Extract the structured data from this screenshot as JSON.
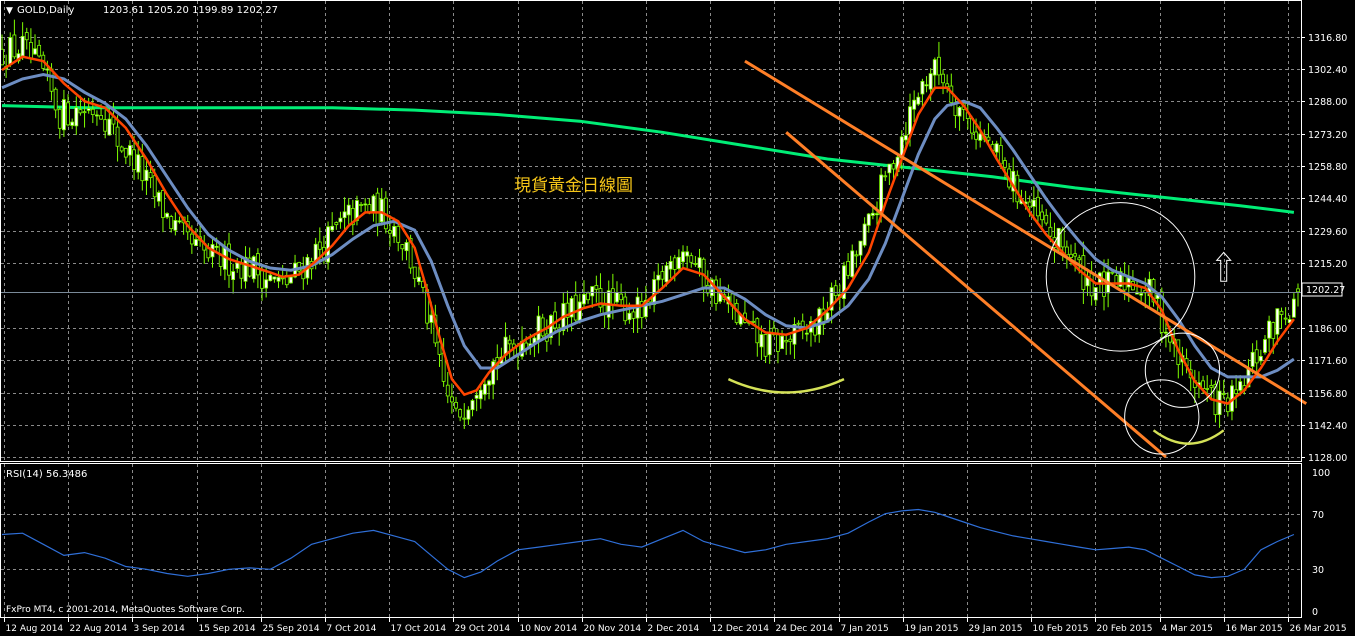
{
  "header": {
    "symbol": "GOLD,Daily",
    "ohlc": "1203.61 1205.20 1199.89 1202.27"
  },
  "annotation": "現貨黃金日線圖",
  "price_marker": "1202.27",
  "rsi_header": "RSI(14) 56.3486",
  "copyright": "FxPro MT4, c 2001-2014, MetaQuotes Software Corp.",
  "colors": {
    "background": "#000000",
    "grid": "#8a8a8a",
    "bull": "#7fff00",
    "bull_body": "#ffffff",
    "bear": "#7fff00",
    "ma_fast": "#ff4500",
    "ma_slow": "#6d8dc2",
    "ma_long": "#00ee76",
    "channel": "#ff7f27",
    "rsi": "#2f6fd8",
    "arc": "#d4e157",
    "text": "#ffffff"
  },
  "chart_data": [
    {
      "type": "candlestick",
      "title": "GOLD,Daily",
      "y_ticks": [
        1316.8,
        1302.4,
        1288.0,
        1273.2,
        1258.8,
        1244.4,
        1229.6,
        1215.2,
        1186.0,
        1171.6,
        1156.8,
        1142.4,
        1128.0
      ],
      "ylim": [
        1128.0,
        1320.0
      ],
      "x_tick_labels": [
        "12 Aug 2014",
        "22 Aug 2014",
        "3 Sep 2014",
        "15 Sep 2014",
        "25 Sep 2014",
        "7 Oct 2014",
        "17 Oct 2014",
        "29 Oct 2014",
        "10 Nov 2014",
        "20 Nov 2014",
        "2 Dec 2014",
        "12 Dec 2014",
        "24 Dec 2014",
        "7 Jan 2015",
        "19 Jan 2015",
        "29 Jan 2015",
        "10 Feb 2015",
        "20 Feb 2015",
        "4 Mar 2015",
        "16 Mar 2015",
        "26 Mar 2015"
      ],
      "last_price": 1202.27,
      "close_path": [
        [
          0,
          1310
        ],
        [
          5,
          1312
        ],
        [
          10,
          1300
        ],
        [
          14,
          1282
        ],
        [
          18,
          1284
        ],
        [
          24,
          1285
        ],
        [
          28,
          1270
        ],
        [
          32,
          1262
        ],
        [
          36,
          1248
        ],
        [
          40,
          1236
        ],
        [
          45,
          1224
        ],
        [
          50,
          1218
        ],
        [
          55,
          1216
        ],
        [
          60,
          1214
        ],
        [
          65,
          1208
        ],
        [
          68,
          1205
        ],
        [
          72,
          1212
        ],
        [
          76,
          1220
        ],
        [
          80,
          1228
        ],
        [
          84,
          1236
        ],
        [
          88,
          1240
        ],
        [
          92,
          1238
        ],
        [
          95,
          1232
        ],
        [
          98,
          1222
        ],
        [
          101,
          1205
        ],
        [
          104,
          1185
        ],
        [
          107,
          1160
        ],
        [
          110,
          1145
        ],
        [
          113,
          1155
        ],
        [
          116,
          1165
        ],
        [
          120,
          1172
        ],
        [
          125,
          1180
        ],
        [
          130,
          1185
        ],
        [
          135,
          1190
        ],
        [
          140,
          1195
        ],
        [
          144,
          1200
        ],
        [
          148,
          1196
        ],
        [
          152,
          1195
        ],
        [
          156,
          1192
        ],
        [
          160,
          1210
        ],
        [
          165,
          1224
        ],
        [
          170,
          1208
        ],
        [
          175,
          1198
        ],
        [
          180,
          1186
        ],
        [
          185,
          1178
        ],
        [
          190,
          1180
        ],
        [
          194,
          1184
        ],
        [
          198,
          1188
        ],
        [
          202,
          1202
        ],
        [
          206,
          1215
        ],
        [
          210,
          1232
        ],
        [
          213,
          1248
        ],
        [
          216,
          1262
        ],
        [
          219,
          1278
        ],
        [
          222,
          1292
        ],
        [
          225,
          1302
        ],
        [
          228,
          1300
        ],
        [
          231,
          1288
        ],
        [
          234,
          1280
        ],
        [
          237,
          1272
        ],
        [
          240,
          1266
        ],
        [
          243,
          1255
        ],
        [
          246,
          1248
        ],
        [
          249,
          1240
        ],
        [
          252,
          1232
        ],
        [
          255,
          1225
        ],
        [
          258,
          1222
        ],
        [
          261,
          1212
        ],
        [
          264,
          1206
        ],
        [
          267,
          1204
        ],
        [
          270,
          1205
        ],
        [
          273,
          1208
        ],
        [
          276,
          1205
        ],
        [
          279,
          1200
        ],
        [
          282,
          1186
        ],
        [
          285,
          1172
        ],
        [
          288,
          1165
        ],
        [
          291,
          1158
        ],
        [
          294,
          1153
        ],
        [
          297,
          1152
        ],
        [
          300,
          1156
        ],
        [
          303,
          1170
        ],
        [
          306,
          1180
        ],
        [
          309,
          1190
        ],
        [
          312,
          1196
        ],
        [
          314,
          1202.27
        ]
      ],
      "ma_fast": [
        [
          0,
          1302
        ],
        [
          5,
          1308
        ],
        [
          10,
          1306
        ],
        [
          15,
          1296
        ],
        [
          20,
          1288
        ],
        [
          25,
          1285
        ],
        [
          30,
          1276
        ],
        [
          35,
          1262
        ],
        [
          40,
          1246
        ],
        [
          45,
          1232
        ],
        [
          50,
          1222
        ],
        [
          55,
          1217
        ],
        [
          60,
          1214
        ],
        [
          65,
          1211
        ],
        [
          68,
          1209
        ],
        [
          72,
          1210
        ],
        [
          76,
          1216
        ],
        [
          80,
          1223
        ],
        [
          84,
          1232
        ],
        [
          88,
          1238
        ],
        [
          92,
          1238
        ],
        [
          96,
          1234
        ],
        [
          100,
          1222
        ],
        [
          103,
          1203
        ],
        [
          106,
          1182
        ],
        [
          109,
          1163
        ],
        [
          112,
          1156
        ],
        [
          115,
          1158
        ],
        [
          118,
          1166
        ],
        [
          122,
          1174
        ],
        [
          127,
          1181
        ],
        [
          132,
          1186
        ],
        [
          136,
          1191
        ],
        [
          141,
          1195
        ],
        [
          145,
          1197
        ],
        [
          150,
          1196
        ],
        [
          155,
          1196
        ],
        [
          160,
          1204
        ],
        [
          165,
          1213
        ],
        [
          170,
          1210
        ],
        [
          175,
          1200
        ],
        [
          180,
          1190
        ],
        [
          185,
          1184
        ],
        [
          190,
          1183
        ],
        [
          195,
          1186
        ],
        [
          200,
          1194
        ],
        [
          205,
          1204
        ],
        [
          210,
          1220
        ],
        [
          214,
          1242
        ],
        [
          218,
          1262
        ],
        [
          222,
          1282
        ],
        [
          226,
          1294
        ],
        [
          229,
          1294
        ],
        [
          233,
          1286
        ],
        [
          237,
          1275
        ],
        [
          241,
          1262
        ],
        [
          245,
          1250
        ],
        [
          249,
          1238
        ],
        [
          253,
          1228
        ],
        [
          257,
          1220
        ],
        [
          261,
          1212
        ],
        [
          265,
          1206
        ],
        [
          269,
          1206
        ],
        [
          273,
          1206
        ],
        [
          277,
          1204
        ],
        [
          281,
          1194
        ],
        [
          285,
          1176
        ],
        [
          289,
          1162
        ],
        [
          293,
          1154
        ],
        [
          297,
          1152
        ],
        [
          301,
          1158
        ],
        [
          305,
          1168
        ],
        [
          309,
          1180
        ],
        [
          313,
          1190
        ]
      ],
      "ma_slow": [
        [
          0,
          1294
        ],
        [
          5,
          1298
        ],
        [
          10,
          1300
        ],
        [
          15,
          1298
        ],
        [
          20,
          1292
        ],
        [
          25,
          1287
        ],
        [
          30,
          1280
        ],
        [
          35,
          1268
        ],
        [
          40,
          1254
        ],
        [
          45,
          1240
        ],
        [
          50,
          1228
        ],
        [
          55,
          1221
        ],
        [
          60,
          1216
        ],
        [
          65,
          1213
        ],
        [
          70,
          1212
        ],
        [
          75,
          1214
        ],
        [
          80,
          1219
        ],
        [
          85,
          1226
        ],
        [
          90,
          1232
        ],
        [
          95,
          1234
        ],
        [
          100,
          1230
        ],
        [
          104,
          1216
        ],
        [
          108,
          1196
        ],
        [
          112,
          1178
        ],
        [
          116,
          1168
        ],
        [
          120,
          1168
        ],
        [
          125,
          1174
        ],
        [
          130,
          1180
        ],
        [
          135,
          1185
        ],
        [
          140,
          1189
        ],
        [
          145,
          1192
        ],
        [
          150,
          1194
        ],
        [
          155,
          1196
        ],
        [
          160,
          1198
        ],
        [
          165,
          1201
        ],
        [
          170,
          1204
        ],
        [
          175,
          1204
        ],
        [
          180,
          1199
        ],
        [
          185,
          1192
        ],
        [
          190,
          1187
        ],
        [
          195,
          1186
        ],
        [
          200,
          1189
        ],
        [
          205,
          1196
        ],
        [
          210,
          1208
        ],
        [
          214,
          1224
        ],
        [
          218,
          1244
        ],
        [
          222,
          1264
        ],
        [
          226,
          1280
        ],
        [
          229,
          1286
        ],
        [
          233,
          1288
        ],
        [
          237,
          1285
        ],
        [
          241,
          1276
        ],
        [
          245,
          1266
        ],
        [
          249,
          1255
        ],
        [
          253,
          1244
        ],
        [
          257,
          1234
        ],
        [
          261,
          1225
        ],
        [
          265,
          1217
        ],
        [
          269,
          1212
        ],
        [
          273,
          1209
        ],
        [
          277,
          1206
        ],
        [
          281,
          1200
        ],
        [
          285,
          1190
        ],
        [
          289,
          1178
        ],
        [
          293,
          1168
        ],
        [
          297,
          1164
        ],
        [
          301,
          1164
        ],
        [
          305,
          1164
        ],
        [
          309,
          1167
        ],
        [
          313,
          1172
        ]
      ],
      "ma_long": [
        [
          0,
          1286
        ],
        [
          20,
          1285
        ],
        [
          40,
          1285
        ],
        [
          60,
          1285
        ],
        [
          80,
          1285
        ],
        [
          100,
          1284
        ],
        [
          120,
          1282
        ],
        [
          140,
          1279
        ],
        [
          160,
          1274
        ],
        [
          180,
          1268
        ],
        [
          200,
          1262
        ],
        [
          220,
          1258
        ],
        [
          240,
          1254
        ],
        [
          260,
          1249
        ],
        [
          280,
          1245
        ],
        [
          300,
          1241
        ],
        [
          313,
          1238
        ]
      ],
      "channel_upper": [
        [
          180,
          1306
        ],
        [
          316,
          1152
        ]
      ],
      "channel_lower": [
        [
          190,
          1274
        ],
        [
          282,
          1128
        ]
      ],
      "circles": [
        [
          271,
          1209,
          18
        ],
        [
          286,
          1167,
          9
        ],
        [
          281,
          1146,
          9
        ]
      ],
      "arcs": [
        {
          "x": [
            176,
            204
          ],
          "depth": 6,
          "y": 1163
        },
        {
          "x": [
            279,
            296
          ],
          "depth": 6,
          "y": 1140
        }
      ],
      "up_arrow": {
        "x": 296,
        "y_from": 1207,
        "y_to": 1220
      }
    },
    {
      "type": "line",
      "title": "RSI(14) 56.3486",
      "y_ticks": [
        100,
        70,
        30,
        0
      ],
      "ylim": [
        0,
        100
      ],
      "values": [
        [
          0,
          55
        ],
        [
          5,
          56
        ],
        [
          10,
          48
        ],
        [
          15,
          40
        ],
        [
          20,
          42
        ],
        [
          25,
          38
        ],
        [
          30,
          32
        ],
        [
          35,
          30
        ],
        [
          40,
          27
        ],
        [
          45,
          25
        ],
        [
          50,
          27
        ],
        [
          55,
          30
        ],
        [
          60,
          31
        ],
        [
          65,
          30
        ],
        [
          70,
          38
        ],
        [
          75,
          48
        ],
        [
          80,
          52
        ],
        [
          85,
          56
        ],
        [
          90,
          58
        ],
        [
          95,
          54
        ],
        [
          100,
          50
        ],
        [
          104,
          40
        ],
        [
          108,
          30
        ],
        [
          112,
          24
        ],
        [
          116,
          28
        ],
        [
          120,
          36
        ],
        [
          125,
          44
        ],
        [
          130,
          46
        ],
        [
          135,
          48
        ],
        [
          140,
          50
        ],
        [
          145,
          52
        ],
        [
          150,
          48
        ],
        [
          155,
          46
        ],
        [
          160,
          52
        ],
        [
          165,
          58
        ],
        [
          170,
          50
        ],
        [
          175,
          46
        ],
        [
          180,
          42
        ],
        [
          185,
          44
        ],
        [
          190,
          48
        ],
        [
          195,
          50
        ],
        [
          200,
          52
        ],
        [
          205,
          56
        ],
        [
          210,
          64
        ],
        [
          214,
          70
        ],
        [
          218,
          72
        ],
        [
          222,
          73
        ],
        [
          226,
          71
        ],
        [
          229,
          68
        ],
        [
          233,
          64
        ],
        [
          237,
          60
        ],
        [
          241,
          57
        ],
        [
          245,
          54
        ],
        [
          249,
          52
        ],
        [
          253,
          50
        ],
        [
          257,
          48
        ],
        [
          261,
          46
        ],
        [
          265,
          44
        ],
        [
          269,
          45
        ],
        [
          273,
          46
        ],
        [
          277,
          44
        ],
        [
          281,
          38
        ],
        [
          285,
          32
        ],
        [
          289,
          26
        ],
        [
          293,
          24
        ],
        [
          297,
          25
        ],
        [
          301,
          30
        ],
        [
          305,
          44
        ],
        [
          309,
          50
        ],
        [
          313,
          55
        ]
      ]
    }
  ]
}
